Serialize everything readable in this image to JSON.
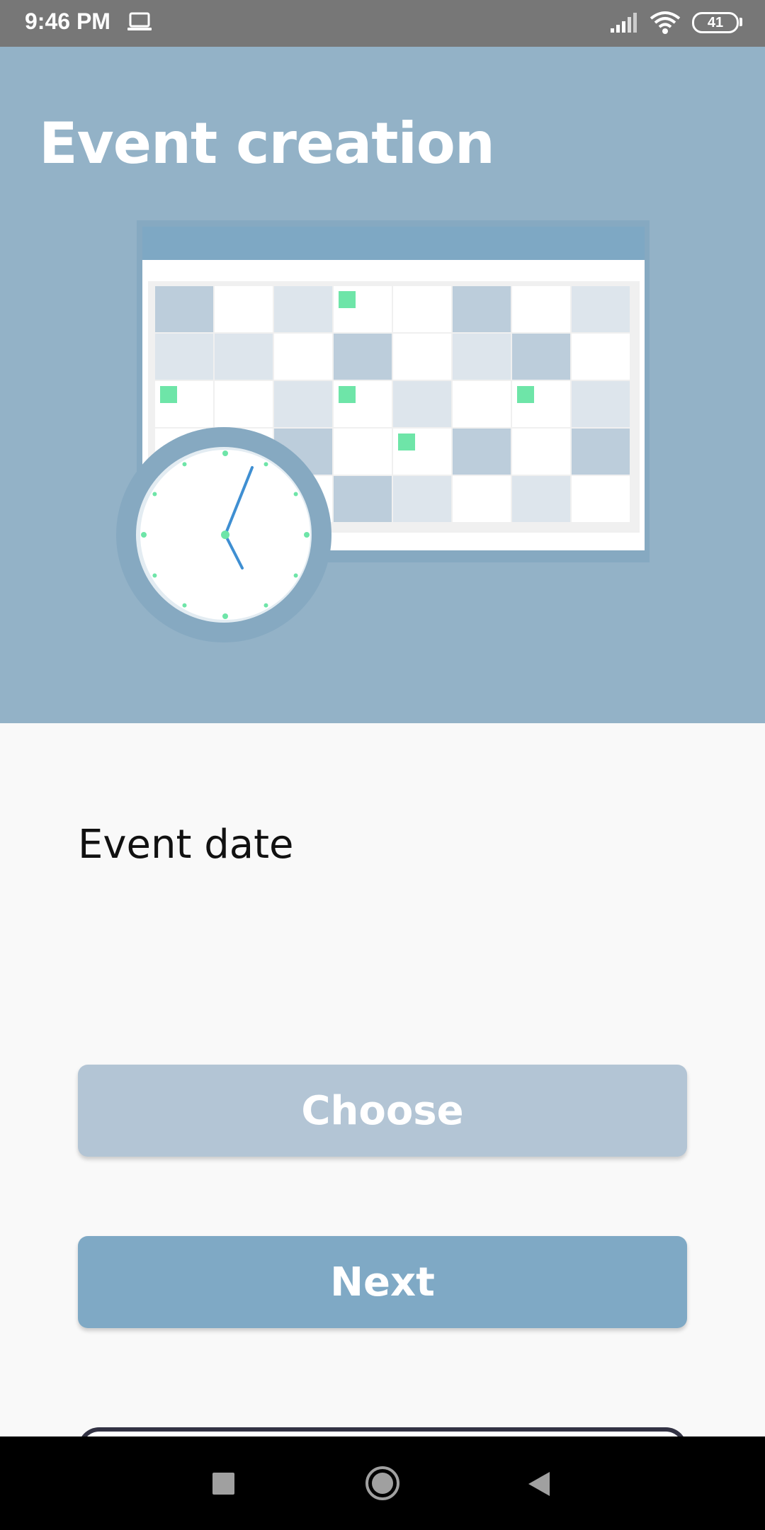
{
  "status_bar": {
    "time": "9:46 PM",
    "battery_level": "41",
    "icons": [
      "laptop-icon",
      "signal-icon",
      "wifi-icon",
      "battery-icon"
    ]
  },
  "hero": {
    "title": "Event creation",
    "illustration": "calendar-with-clock",
    "background_color": "#93b2c7"
  },
  "form": {
    "field_label": "Event date",
    "choose_label": "Choose",
    "next_label": "Next"
  },
  "colors": {
    "choose_button": "#b3c5d5",
    "next_button": "#7fa9c5",
    "accent_green": "#6ee5a8"
  },
  "nav_bar": {
    "icons": [
      "recents-icon",
      "home-icon",
      "back-icon"
    ]
  }
}
